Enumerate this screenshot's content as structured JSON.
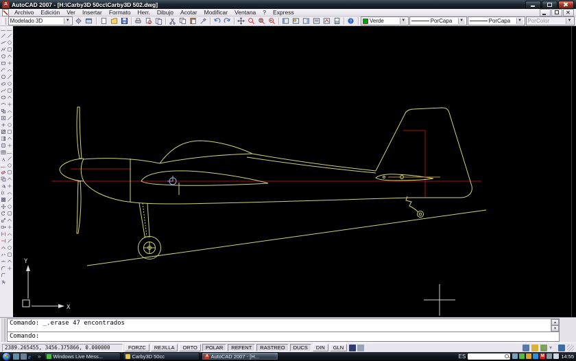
{
  "colors": {
    "line-yellow": "#d2d27c",
    "line-red": "#a31212",
    "line-orange": "#c09225",
    "cg": "#a7adde",
    "cursor": "#d2d2d2",
    "ucs": "#dcdcdc"
  },
  "window": {
    "title": "AutoCAD 2007 - [H:\\Carby3D 50cc\\Carby3D 502.dwg]"
  },
  "menu": {
    "items": [
      "Archivo",
      "Edición",
      "Ver",
      "Insertar",
      "Formato",
      "Herr.",
      "Dibujo",
      "Acotar",
      "Modificar",
      "Ventana",
      "?",
      "Express"
    ]
  },
  "toolbar": {
    "workspace_value": "Modelado 3D",
    "workspace_buttons": [
      "workspace-settings",
      "my-workspace"
    ],
    "standard_groups": [
      [
        "qnew",
        "open",
        "save"
      ],
      [
        "plot",
        "plot-preview",
        "publish"
      ],
      [
        "cut",
        "copy",
        "paste",
        "match-properties"
      ],
      [
        "undo",
        "redo"
      ],
      [
        "pan",
        "zoom-realtime",
        "zoom-window",
        "zoom-previous"
      ],
      [
        "properties",
        "designcenter",
        "tool-palettes",
        "sheetset-manager",
        "markup-manager",
        "quickcalc"
      ],
      [
        "help"
      ]
    ],
    "color_value": "Verde",
    "linetype_value": "PorCapa",
    "lineweight_value": "PorCapa",
    "plotstyle_value": "PorColor"
  },
  "sidebar": {
    "draw_tools": [
      "line",
      "construction-line",
      "polyline",
      "polygon",
      "rectangle",
      "arc",
      "circle",
      "revision-cloud",
      "spline",
      "ellipse",
      "ellipse-arc",
      "insert-block",
      "make-block",
      "point",
      "hatch",
      "gradient",
      "region",
      "table",
      "multiline-text"
    ],
    "modify_tools": [
      "erase",
      "copy-object",
      "mirror",
      "offset",
      "array",
      "move",
      "rotate",
      "scale",
      "stretch",
      "trim",
      "extend",
      "break-at-point",
      "break",
      "join",
      "chamfer",
      "fillet",
      "explode"
    ],
    "column2_group_counts": [
      17,
      17
    ]
  },
  "command": {
    "history_lines": [
      "Comando: _.erase 47 encontrados"
    ],
    "prompt": "Comando:"
  },
  "statusbar": {
    "coordinates": "2389.265455, 3456.375866, 0.000000",
    "toggles": [
      {
        "label": "FORZC",
        "pressed": false
      },
      {
        "label": "REJILLA",
        "pressed": false
      },
      {
        "label": "ORTO",
        "pressed": false
      },
      {
        "label": "POLAR",
        "pressed": true
      },
      {
        "label": "REFENT",
        "pressed": true
      },
      {
        "label": "RASTREO",
        "pressed": true
      },
      {
        "label": "DUCS",
        "pressed": true
      },
      {
        "label": "DIN",
        "pressed": false
      },
      {
        "label": "GLN",
        "pressed": false
      }
    ],
    "icon_buttons": [
      {
        "name": "model-space-icon",
        "color": "#2d3e6e"
      },
      {
        "name": "layout-icon",
        "color": "#9aa4b4"
      }
    ],
    "right_icons": [
      {
        "name": "annotation-scale-icon",
        "color": "#5b79a8"
      },
      {
        "name": "lock-icon",
        "color": "#d8b23a"
      },
      {
        "name": "tray-settings-icon",
        "color": "#7fa05a"
      },
      {
        "name": "caret-down-icon",
        "color": "#8a8f99",
        "glyph": "▾"
      },
      {
        "name": "clean-screen-icon",
        "color": "#3b6ea5"
      }
    ]
  },
  "taskbar": {
    "quick_launch": [
      {
        "name": "show-desktop-icon",
        "color": "#5b8fa8"
      },
      {
        "name": "window-switcher-icon",
        "color": "#6b7f95"
      },
      {
        "name": "internet-explorer-icon",
        "color": "#2f7fd0",
        "glyph": "e"
      }
    ],
    "overflow_chevron": "»",
    "tasks": [
      {
        "label": "Windows Live Mess...",
        "icon": "messenger",
        "active": false
      },
      {
        "label": "Carby3D 50cc",
        "icon": "folder",
        "active": false
      },
      {
        "label": "AutoCAD 2007 - [H...",
        "icon": "autocad",
        "active": true
      }
    ],
    "language_indicator": "ES",
    "tray_icons": [
      {
        "name": "network-icon",
        "color": "#7aa0b8"
      },
      {
        "name": "messenger-status-icon",
        "color": "#57b847"
      },
      {
        "name": "update-icon",
        "color": "#d8a828"
      },
      {
        "name": "app-tray-icon",
        "color": "#2e8fd8"
      },
      {
        "name": "m-agent-icon",
        "color": "#cc2222",
        "glyph": "M"
      },
      {
        "name": "display-icon",
        "color": "#8a97a6"
      },
      {
        "name": "volume-icon",
        "color": "#cfd8e2"
      }
    ],
    "clock": "14:55"
  },
  "canvas": {
    "ucs": {
      "x_label": "X",
      "y_label": "Y"
    }
  }
}
